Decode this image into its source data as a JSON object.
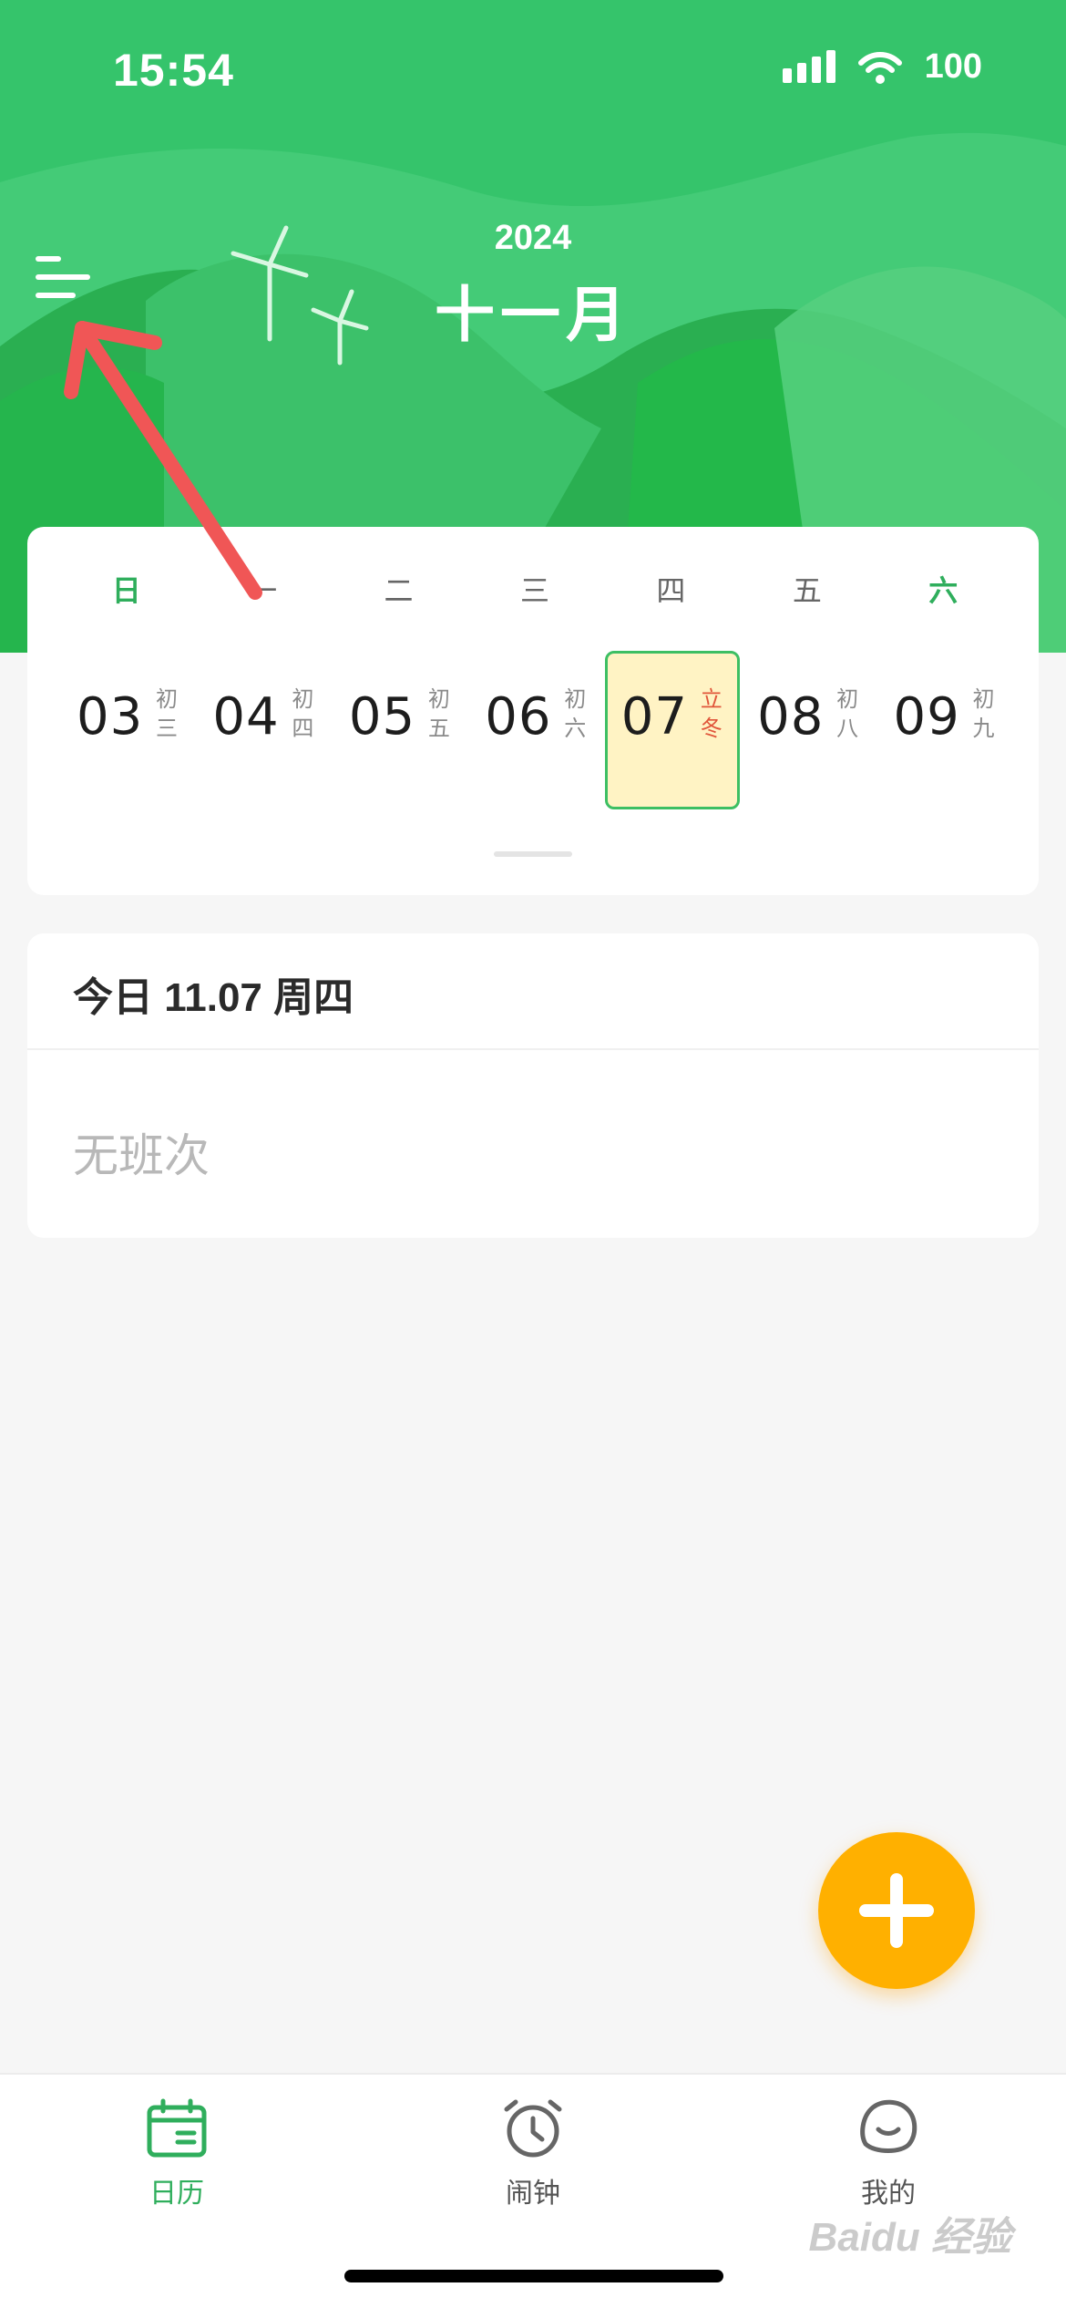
{
  "status_bar": {
    "time": "15:54",
    "battery": "100",
    "icons": [
      "signal-icon",
      "wifi-icon"
    ]
  },
  "header": {
    "year": "2024",
    "month": "十一月",
    "menu_icon": "menu-icon"
  },
  "calendar": {
    "weekdays": [
      "日",
      "一",
      "二",
      "三",
      "四",
      "五",
      "六"
    ],
    "days": [
      {
        "num": "03",
        "lunar1": "初",
        "lunar2": "三"
      },
      {
        "num": "04",
        "lunar1": "初",
        "lunar2": "四"
      },
      {
        "num": "05",
        "lunar1": "初",
        "lunar2": "五"
      },
      {
        "num": "06",
        "lunar1": "初",
        "lunar2": "六"
      },
      {
        "num": "07",
        "lunar1": "立",
        "lunar2": "冬"
      },
      {
        "num": "08",
        "lunar1": "初",
        "lunar2": "八"
      },
      {
        "num": "09",
        "lunar1": "初",
        "lunar2": "九"
      }
    ],
    "selected_index": 4
  },
  "today": {
    "title": "今日 11.07 周四",
    "shift": "无班次"
  },
  "fab": {
    "icon": "plus-icon"
  },
  "bottom_nav": {
    "items": [
      {
        "label": "日历",
        "icon": "calendar-icon",
        "active": true
      },
      {
        "label": "闹钟",
        "icon": "alarm-clock-icon",
        "active": false
      },
      {
        "label": "我的",
        "icon": "profile-icon",
        "active": false
      }
    ]
  },
  "watermark": "Baidu 经验",
  "colors": {
    "header_green": "#35c46b",
    "accent_green": "#2fae5c",
    "fab_orange": "#ffb000",
    "selected_bg": "#fff3c4",
    "solar_term_red": "#e0553a"
  }
}
